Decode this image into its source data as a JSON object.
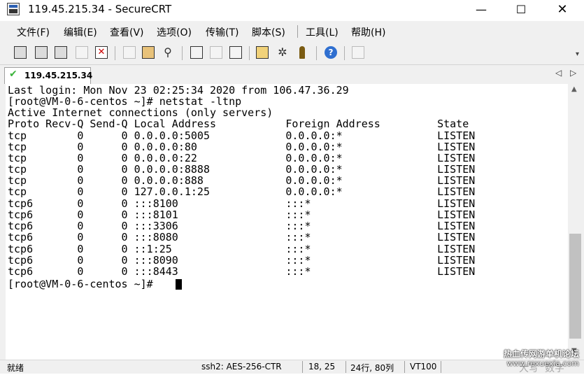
{
  "window": {
    "title": "119.45.215.34 - SecureCRT",
    "minimize": "—",
    "maximize": "☐",
    "close": "✕"
  },
  "menu": {
    "items": [
      "文件(F)",
      "编辑(E)",
      "查看(V)",
      "选项(O)",
      "传输(T)",
      "脚本(S)",
      "工具(L)",
      "帮助(H)"
    ]
  },
  "toolbar": {
    "icons": [
      "connect-icon",
      "quick-connect-icon",
      "connect-in-tab-icon",
      "reconnect-icon",
      "disconnect-icon",
      "copy-icon",
      "paste-icon",
      "find-icon",
      "print-icon",
      "print-selection-icon",
      "print-setup-icon",
      "session-options-icon",
      "global-options-icon",
      "keymap-icon",
      "help-icon",
      "screenshot-icon"
    ]
  },
  "tab": {
    "label": "119.45.215.34",
    "status": "connected",
    "prev": "◁",
    "next": "▷"
  },
  "terminal": {
    "lines": [
      "Last login: Mon Nov 23 02:25:34 2020 from 106.47.36.29",
      "[root@VM-0-6-centos ~]# netstat -ltnp",
      "Active Internet connections (only servers)",
      "Proto Recv-Q Send-Q Local Address           Foreign Address         State",
      "tcp        0      0 0.0.0.0:5005            0.0.0.0:*               LISTEN",
      "tcp        0      0 0.0.0.0:80              0.0.0.0:*               LISTEN",
      "tcp        0      0 0.0.0.0:22              0.0.0.0:*               LISTEN",
      "tcp        0      0 0.0.0.0:8888            0.0.0.0:*               LISTEN",
      "tcp        0      0 0.0.0.0:888             0.0.0.0:*               LISTEN",
      "tcp        0      0 127.0.0.1:25            0.0.0.0:*               LISTEN",
      "tcp6       0      0 :::8100                 :::*                    LISTEN",
      "tcp6       0      0 :::8101                 :::*                    LISTEN",
      "tcp6       0      0 :::3306                 :::*                    LISTEN",
      "tcp6       0      0 :::8080                 :::*                    LISTEN",
      "tcp6       0      0 ::1:25                  :::*                    LISTEN",
      "tcp6       0      0 :::8090                 :::*                    LISTEN",
      "tcp6       0      0 :::8443                 :::*                    LISTEN",
      "[root@VM-0-6-centos ~]# "
    ]
  },
  "scrollbar": {
    "up": "▲",
    "down": "▼"
  },
  "status": {
    "ready": "就绪",
    "protocol": "ssh2: AES-256-CTR",
    "cursor_pos": "18, 25",
    "size": "24行, 80列",
    "terminal_type": "VT100",
    "caps": "大写",
    "num": "数字"
  },
  "watermark": {
    "line1": "热血传网游单机论坛",
    "line2": "www.rexuexia.com"
  }
}
